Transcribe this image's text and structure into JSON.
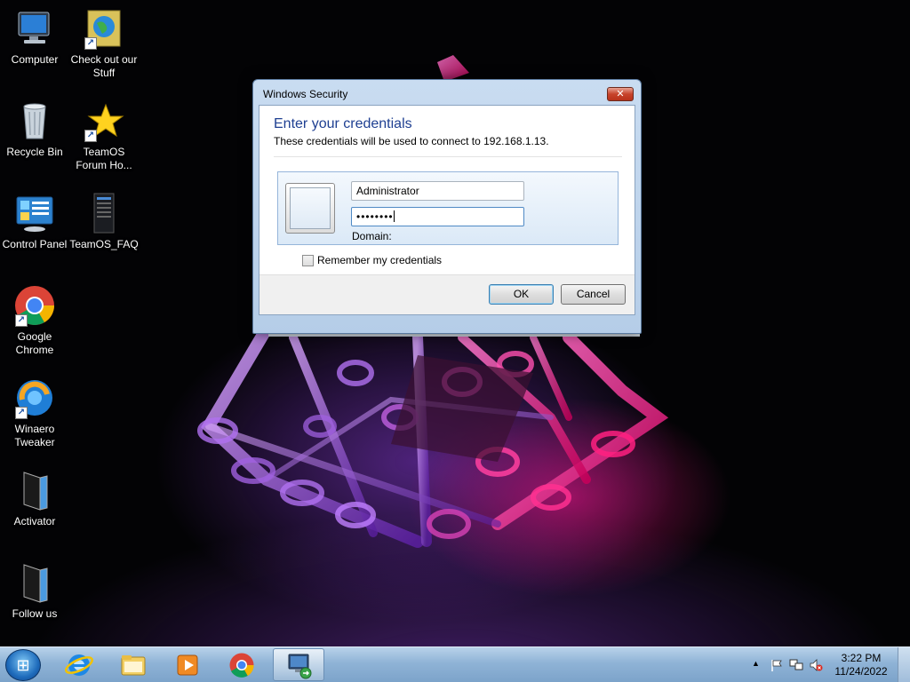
{
  "desktop": {
    "icons": [
      {
        "label": "Computer",
        "icon": "computer-icon"
      },
      {
        "label": "Check out our Stuff",
        "icon": "globe-shortcut-icon"
      },
      {
        "label": "Recycle Bin",
        "icon": "recycle-bin-icon"
      },
      {
        "label": "TeamOS Forum Ho...",
        "icon": "star-shortcut-icon"
      },
      {
        "label": "Control Panel",
        "icon": "control-panel-icon"
      },
      {
        "label": "TeamOS_FAQ",
        "icon": "document-icon"
      },
      {
        "label": "Google Chrome",
        "icon": "chrome-icon"
      },
      {
        "label": "Winaero Tweaker",
        "icon": "winaero-icon"
      },
      {
        "label": "Activator",
        "icon": "activator-icon"
      },
      {
        "label": "Follow us",
        "icon": "follow-us-icon"
      }
    ]
  },
  "dialog": {
    "title": "Windows Security",
    "close_glyph": "✕",
    "heading": "Enter your credentials",
    "subtext": "These credentials will be used to connect to 192.168.1.13.",
    "username_value": "Administrator",
    "password_value": "••••••••",
    "domain_label": "Domain:",
    "remember_label": "Remember my credentials",
    "remember_checked": false,
    "ok_label": "OK",
    "cancel_label": "Cancel"
  },
  "taskbar": {
    "start_glyph": "⊞",
    "pinned": [
      {
        "icon": "internet-explorer-icon"
      },
      {
        "icon": "file-explorer-icon"
      },
      {
        "icon": "media-player-icon"
      },
      {
        "icon": "chrome-icon"
      },
      {
        "icon": "remote-desktop-icon",
        "active": true
      }
    ],
    "tray": {
      "expand_glyph": "▲",
      "time": "3:22 PM",
      "date": "11/24/2022"
    }
  },
  "colors": {
    "dialog_heading": "#1e3f91",
    "taskbar": "#8fb3d6",
    "wallpaper_pink": "#ff148c",
    "wallpaper_purple": "#8c3cdc"
  }
}
